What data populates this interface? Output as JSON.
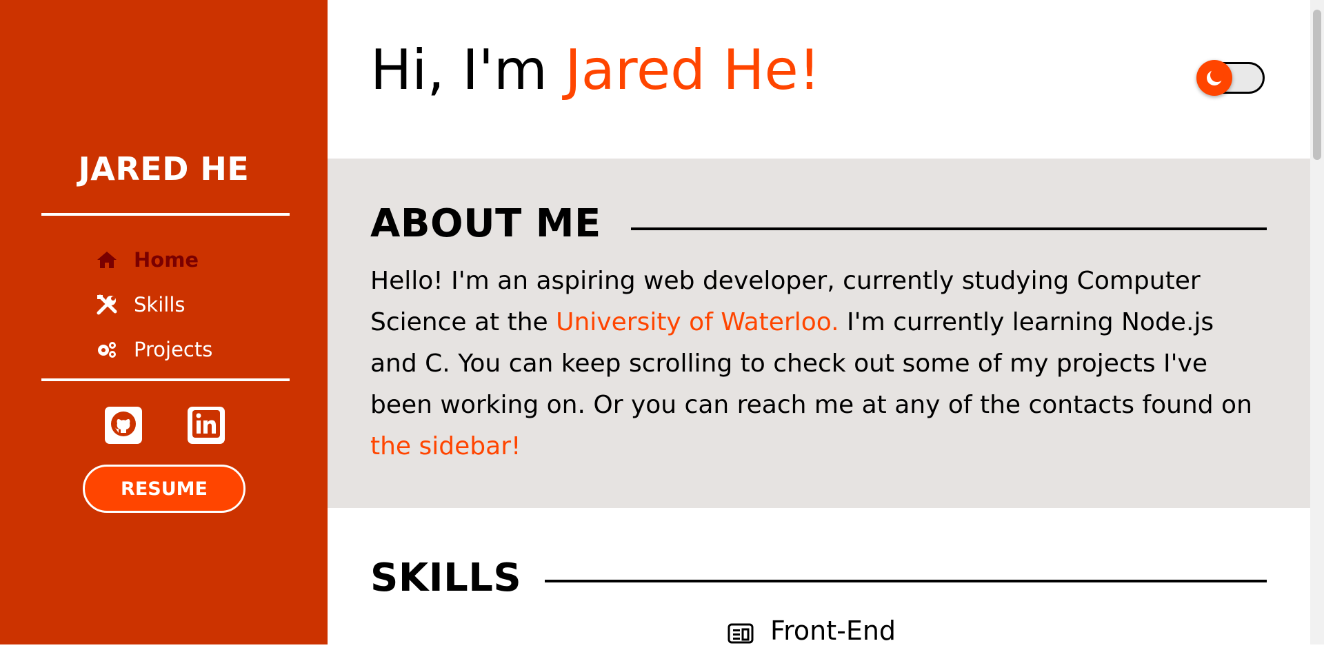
{
  "sidebar": {
    "brand": "JARED HE",
    "nav": [
      {
        "label": "Home",
        "icon": "home-icon",
        "active": true
      },
      {
        "label": "Skills",
        "icon": "tools-icon",
        "active": false
      },
      {
        "label": "Projects",
        "icon": "gears-icon",
        "active": false
      }
    ],
    "socials": [
      "github-icon",
      "linkedin-icon"
    ],
    "resume_label": "RESUME"
  },
  "hero": {
    "greeting": "Hi, I'm ",
    "name": "Jared He!"
  },
  "theme_toggle": {
    "icon": "moon-icon"
  },
  "about": {
    "title": "ABOUT ME",
    "text_1": "Hello! I'm an aspiring web developer, currently studying Computer Science at the ",
    "link_1": "University of Waterloo.",
    "text_2": " I'm currently learning Node.js and C. You can keep scrolling to check out some of my projects I've been working on. Or you can reach me at any of the contacts found on ",
    "link_2": "the sidebar!"
  },
  "skills": {
    "title": "SKILLS",
    "first_category": "Front-End"
  },
  "colors": {
    "sidebar": "#cc3300",
    "accent": "#ff4500",
    "active_nav": "#7a0000",
    "about_bg": "#e6e3e1"
  }
}
